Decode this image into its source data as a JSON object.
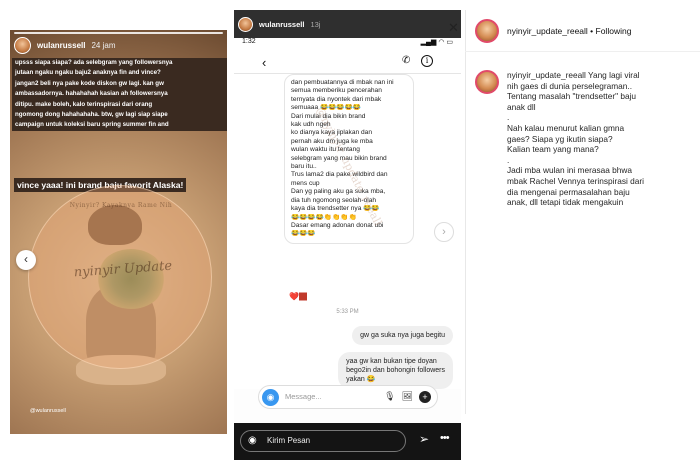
{
  "story": {
    "username": "wulanrussell",
    "time": "24 jam",
    "caption_lines": [
      "upsss siapa siapa? ada selebgram yang followersnya",
      "jutaan ngaku ngaku baju2 anaknya fin and vince?",
      "jangan2 beli nya pake kode diskon gw lagi. kan gw",
      "ambassadornya. hahahahah kasian ah followersnya",
      "ditipu. make boleh, kalo terinspirasi dari orang",
      "ngomong dong hahahahaha. btw, gw lagi siap siape",
      "campaign untuk koleksi baru spring summer fin and"
    ],
    "tagline": "vince yaaa! ini brand baju favorit Alaska!",
    "watermark_main": "nyinyir Update",
    "watermark_ring": "Nyinyir? Kayaknya Rame Nih",
    "handle": "@wulanrussell",
    "nav_left": "‹"
  },
  "dm": {
    "story_user": "wulanrussell",
    "story_time": "13j",
    "clock": "1:32",
    "status_icons": "▂▄▆ ◠ ▭",
    "back": "‹",
    "call_icon": "✆",
    "info_icon": "i",
    "watermark": "@nyinyir_update_reeall",
    "incoming_lines": [
      "dan pembuatannya di mbak nan ini",
      "semua memberiku pencerahan",
      "ternyata dia nyontek dari mbak",
      "semuaaa 😂😂😂😂😂",
      "Dari mulai dia bikin brand",
      "                        kak udh ngeh",
      "ko dianya kaya jiplakan dan",
      "pernah aku dm juga ke mba",
      "wulan waktu itu tentang",
      "selebgram yang mau bikin brand",
      "baru itu..",
      "Trus lama2 dia pake wildbird dan",
      "mens cup",
      "Dan yg paling aku ga suka mba,",
      "dia tuh ngomong seolah-olah",
      "kaya dia trendsetter nya 😂😂",
      "😂😂😂😂👏👏👏👏",
      "Dasar emang adonan donat ubi",
      "😂😂😂"
    ],
    "reaction": "❤️🏿",
    "timestamp": "5:33 PM",
    "outgoing": [
      "gw ga suka nya juga begitu",
      "yaa gw kan bukan tipe doyan",
      "bego2in dan bohongin followers",
      "yakan 😂"
    ],
    "nav_right": "›",
    "camera_icon": "◉",
    "composer_placeholder": "Message...",
    "mic_icon": "🎙",
    "gallery_icon": "🖼",
    "plus_icon": "+",
    "reply_placeholder": "Kirim Pesan",
    "send_icon": "➢",
    "more_icon": "•••"
  },
  "post": {
    "close_icon": "✕",
    "header_username": "nyinyir_update_reeall",
    "header_sep": " • ",
    "follow_status": "Following",
    "caption_username": "nyinyir_update_reeall",
    "caption_lines": [
      "Yang lagi viral",
      "nih gaes di dunia perselegraman..",
      "Tentang masalah \"trendsetter\" baju",
      "anak dll",
      ".",
      "Nah kalau menurut kalian gmna",
      "gaes? Siapa yg ikutin siapa?",
      "Kalian team yang mana?",
      ".",
      "Jadi mba wulan ini merasaa bhwa",
      "mbak Rachel Vennya terinspirasi dari",
      "dia mengenai permasalahan baju",
      "anak, dll tetapi tidak mengakuin"
    ]
  }
}
